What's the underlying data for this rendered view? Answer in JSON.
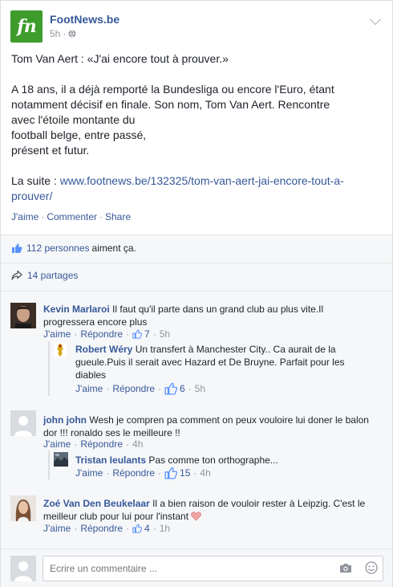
{
  "post": {
    "page_name": "FootNews.be",
    "logo_text": "fn",
    "time": "5h",
    "title_line": "Tom Van Aert : «J'ai encore tout à prouver.»",
    "body_lines": [
      "A 18 ans, il a déjà remporté la Bundesliga ou encore l'Euro, étant",
      "notamment décisif en finale. Son nom, Tom Van Aert. Rencontre",
      "avec l'étoile montante du",
      "football belge, entre passé,",
      "présent et futur."
    ],
    "link_prefix": "La suite : ",
    "link_line1": "www.footnews.be/132325/tom-van-aert-jai-encore-tout-a-",
    "link_line2": "prouver/",
    "actions": {
      "like": "J'aime",
      "comment": "Commenter",
      "share": "Share",
      "separator": "·"
    }
  },
  "summary": {
    "likes_count": "112 personnes",
    "likes_suffix": "aiment ça.",
    "shares": "14 partages"
  },
  "comments": [
    {
      "author": "Kevin Marlaroi",
      "text": "Il faut qu'il parte dans un grand club au plus vite.Il progressera encore plus",
      "like": "J'aime",
      "reply": "Répondre",
      "likes": "7",
      "time": "5h"
    },
    {
      "author": "Robert Wéry",
      "text": "Un transfert à Manchester City.. Ca aurait de la gueule.Puis il serait avec Hazard et De Bruyne. Parfait pour les diables",
      "like": "J'aime",
      "reply": "Répondre",
      "likes": "6",
      "time": "5h"
    },
    {
      "author": "john john",
      "text": "Wesh je compren pa comment on peux vouloire lui doner le balon dor !!! ronaldo ses le meilleure !!",
      "like": "J'aime",
      "reply": "Répondre",
      "time": "4h"
    },
    {
      "author": "Tristan Ieulants",
      "text": "Pas comme ton orthographe...",
      "like": "J'aime",
      "reply": "Répondre",
      "likes": "15",
      "time": "4h"
    },
    {
      "author": "Zoé Van Den Beukelaar",
      "text": "Il a bien raison de vouloir rester à Leipzig. C'est le meilleur club pour lui pour l'instant",
      "like": "J'aime",
      "reply": "Répondre",
      "likes": "4",
      "time": "1h"
    }
  ],
  "composer": {
    "placeholder": "Ecrire un commentaire ..."
  },
  "colors": {
    "link": "#365899",
    "meta": "#90949c",
    "logo": "#3e9c2c",
    "background": "#f6f7f9"
  }
}
